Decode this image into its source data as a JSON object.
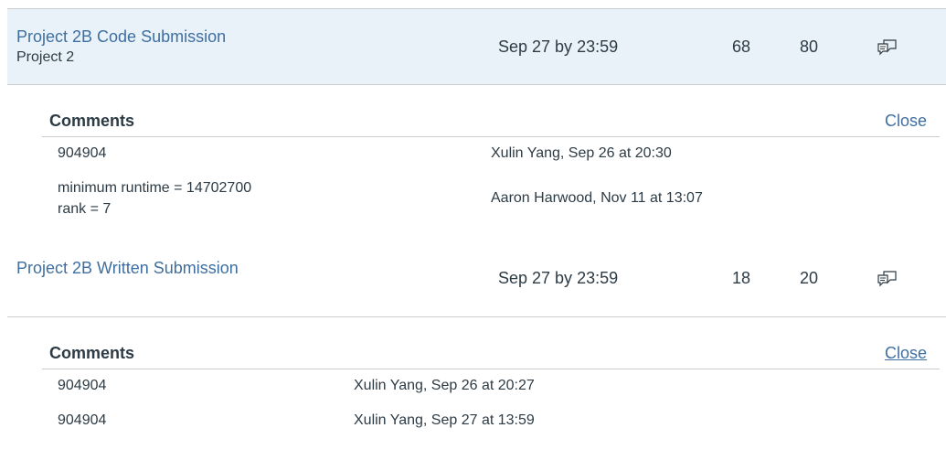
{
  "assignments": [
    {
      "title": "Project 2B Code Submission",
      "group": "Project 2",
      "due": "Sep 27 by 23:59",
      "score": "68",
      "possible": "80",
      "icon": "comment-bubbles-icon",
      "comments": {
        "heading": "Comments",
        "close_label": "Close",
        "items": [
          {
            "lines": [
              "904904"
            ],
            "author": "Xulin Yang, Sep 26 at 20:30"
          },
          {
            "lines": [
              "minimum runtime = 14702700",
              "rank = 7"
            ],
            "author": "Aaron Harwood, Nov 11 at 13:07"
          }
        ]
      }
    },
    {
      "title": "Project 2B Written Submission",
      "group": "",
      "due": "Sep 27 by 23:59",
      "score": "18",
      "possible": "20",
      "icon": "comment-bubbles-icon",
      "comments": {
        "heading": "Comments",
        "close_label": "Close",
        "items": [
          {
            "lines": [
              "904904"
            ],
            "author": "Xulin Yang, Sep 26 at 20:27"
          },
          {
            "lines": [
              "904904"
            ],
            "author": "Xulin Yang, Sep 27 at 13:59"
          }
        ]
      }
    }
  ],
  "colors": {
    "link": "#3f6fa0",
    "highlight_row": "#e8f2f8",
    "divider": "#c7cdd1",
    "text": "#2d3b45"
  }
}
